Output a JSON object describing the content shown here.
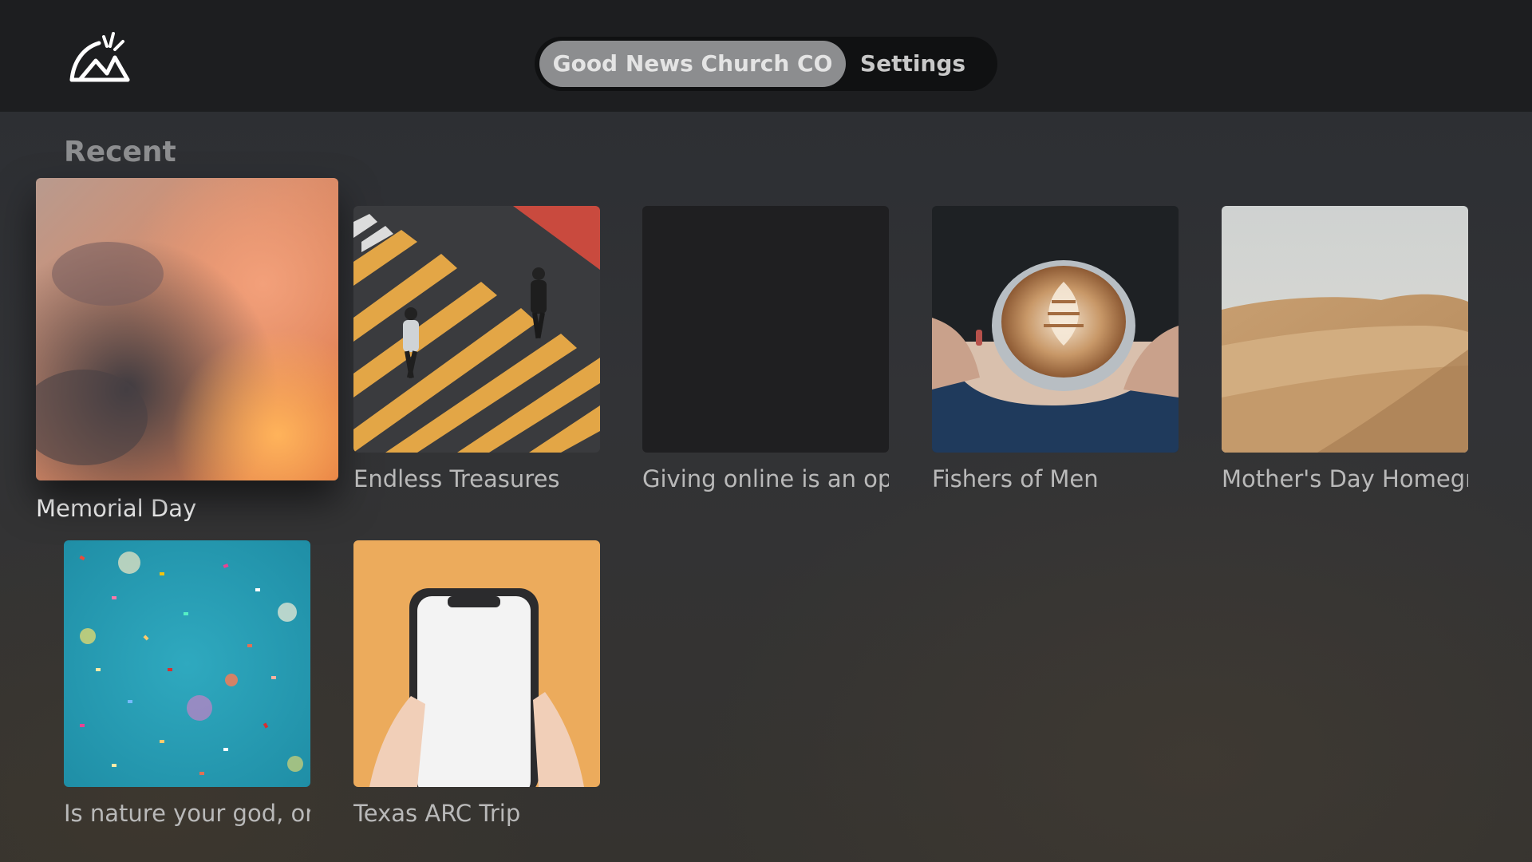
{
  "header": {
    "logo_icon": "mountain-sun-logo-icon",
    "tabs": [
      {
        "label": "Good News Church CO",
        "active": true
      },
      {
        "label": "Settings",
        "active": false
      }
    ]
  },
  "section": {
    "title": "Recent"
  },
  "items": [
    {
      "title": "Memorial Day",
      "image": "sunset-clouds",
      "focused": true
    },
    {
      "title": "Endless Treasures",
      "image": "crosswalk-pedestrians"
    },
    {
      "title": "Giving online is an opti",
      "image": "blank-dark"
    },
    {
      "title": "Fishers of Men",
      "image": "latte-cup-hands"
    },
    {
      "title": "Mother's Day Homegr",
      "image": "desert-dunes"
    },
    {
      "title": "Is nature your god, or a",
      "image": "confetti-teal"
    },
    {
      "title": "Texas ARC Trip",
      "image": "phone-in-hands-orange"
    }
  ],
  "colors": {
    "topbar": "#1d1e20",
    "active_tab": "#8c8d8f",
    "nav_pill": "#101112"
  }
}
